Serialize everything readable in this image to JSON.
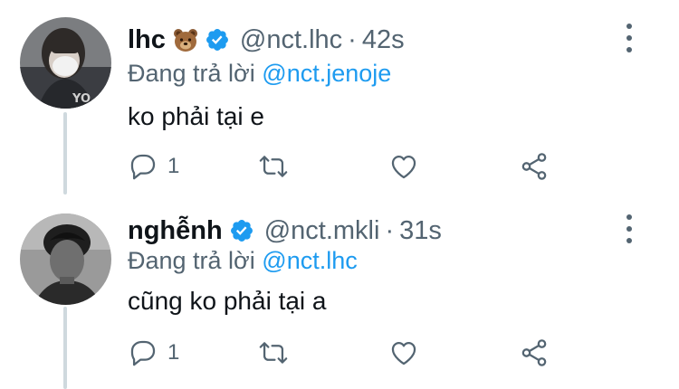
{
  "tweets": [
    {
      "name": "lhc",
      "name_emoji": "bear-face-emoji",
      "verified": true,
      "handle": "@nct.lhc",
      "separator": "·",
      "time": "42s",
      "reply_prefix": "Đang trả lời",
      "reply_to": "@nct.jenoje",
      "text": "ko phải tại e",
      "reply_count": "1",
      "icons": [
        "reply-icon",
        "retweet-icon",
        "like-icon",
        "share-icon",
        "more-icon"
      ]
    },
    {
      "name": "nghễnh",
      "verified": true,
      "handle": "@nct.mkli",
      "separator": "·",
      "time": "31s",
      "reply_prefix": "Đang trả lời",
      "reply_to": "@nct.lhc",
      "text": "cũng ko phải tại a",
      "reply_count": "1",
      "icons": [
        "reply-icon",
        "retweet-icon",
        "like-icon",
        "share-icon",
        "more-icon"
      ]
    }
  ],
  "colors": {
    "text_primary": "#0f1419",
    "text_secondary": "#536471",
    "link": "#1d9bf0",
    "verified": "#1d9bf0",
    "thread_line": "#cfd9de"
  }
}
